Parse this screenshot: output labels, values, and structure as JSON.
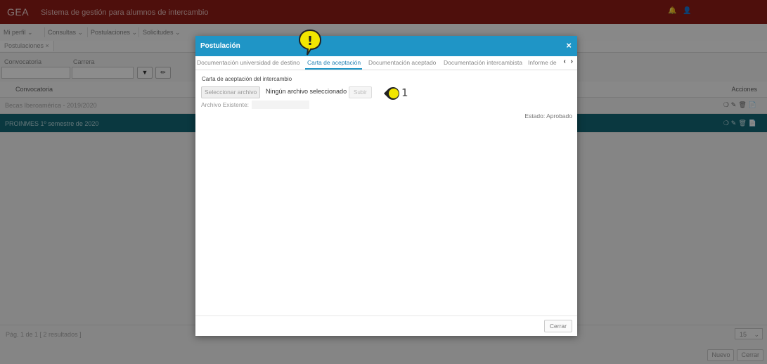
{
  "app": {
    "brand": "GEA",
    "subtitle": "Sistema de gestión para alumnos de intercambio",
    "top_icons": [
      "bell-icon",
      "user-icon"
    ]
  },
  "menu": {
    "items": [
      "Mi perfil ⌄",
      "Consultas ⌄",
      "Postulaciones ⌄",
      "Solicitudes ⌄"
    ]
  },
  "page_tab": {
    "label": "Postulaciones ×"
  },
  "filters": {
    "convocatoria_label": "Convocatoria",
    "carrera_label": "Carrera",
    "filter_icon": "filter-icon",
    "clear_icon": "eraser-icon"
  },
  "grid": {
    "header_convocatoria": "Convocatoria",
    "header_acciones": "Acciones",
    "rows": [
      {
        "label": "Becas Iberoamérica - 2019/2020",
        "selected": false
      },
      {
        "label": "PROINMES 1º semestre de 2020",
        "selected": true
      }
    ],
    "row_actions": [
      "info-icon",
      "edit-icon",
      "delete-icon",
      "document-icon"
    ]
  },
  "pager": {
    "text": "Pág. 1 de 1 [ 2 resultados ]",
    "page_size": "15"
  },
  "bottom_buttons": {
    "new": "Nuevo",
    "close": "Cerrar"
  },
  "modal": {
    "title": "Postulación",
    "close_symbol": "×",
    "tabs": [
      {
        "label": "Documentación universidad de destino",
        "active": false
      },
      {
        "label": "Carta de aceptación",
        "active": true
      },
      {
        "label": "Documentación aceptado",
        "active": false
      },
      {
        "label": "Documentación intercambista",
        "active": false
      },
      {
        "label": "Informe de",
        "active": false
      }
    ],
    "tab_scroll": "‹ ›",
    "section_label": "Carta de aceptación del intercambio",
    "select_file": "Seleccionar archivo",
    "no_file": "Ningún archivo seleccionado",
    "upload": "Subir",
    "existing_label": "Archivo Existente:",
    "status": "Estado: Aprobado",
    "footer_close": "Cerrar"
  },
  "annotations": {
    "warning_symbol": "!",
    "marker_number": "1",
    "marker_color": "#f2e600"
  }
}
